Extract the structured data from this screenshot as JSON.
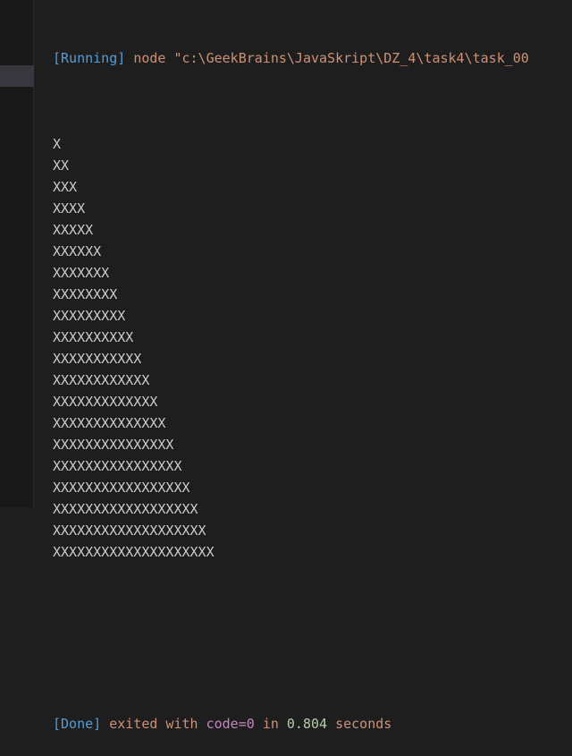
{
  "terminal": {
    "running_tag": "[Running]",
    "command": "node \"c:\\GeekBrains\\JavaSkript\\DZ_4\\task4\\task_00",
    "output_lines": [
      "X",
      "XX",
      "XXX",
      "XXXX",
      "XXXXX",
      "XXXXXX",
      "XXXXXXX",
      "XXXXXXXX",
      "XXXXXXXXX",
      "XXXXXXXXXX",
      "XXXXXXXXXXX",
      "XXXXXXXXXXXX",
      "XXXXXXXXXXXXX",
      "XXXXXXXXXXXXXX",
      "XXXXXXXXXXXXXXX",
      "XXXXXXXXXXXXXXXX",
      "XXXXXXXXXXXXXXXXX",
      "XXXXXXXXXXXXXXXXXX",
      "XXXXXXXXXXXXXXXXXXX",
      "XXXXXXXXXXXXXXXXXXXX"
    ],
    "done": {
      "tag": "[Done]",
      "exited_with": "exited with",
      "code": "code=0",
      "in_word": "in",
      "seconds_value": "0.804",
      "seconds_word": "seconds"
    }
  },
  "colors": {
    "background": "#1e1e1e",
    "tag": "#569cd6",
    "string": "#ce9178",
    "keyword": "#c586c0",
    "number": "#b5cea8",
    "text": "#cccccc"
  }
}
